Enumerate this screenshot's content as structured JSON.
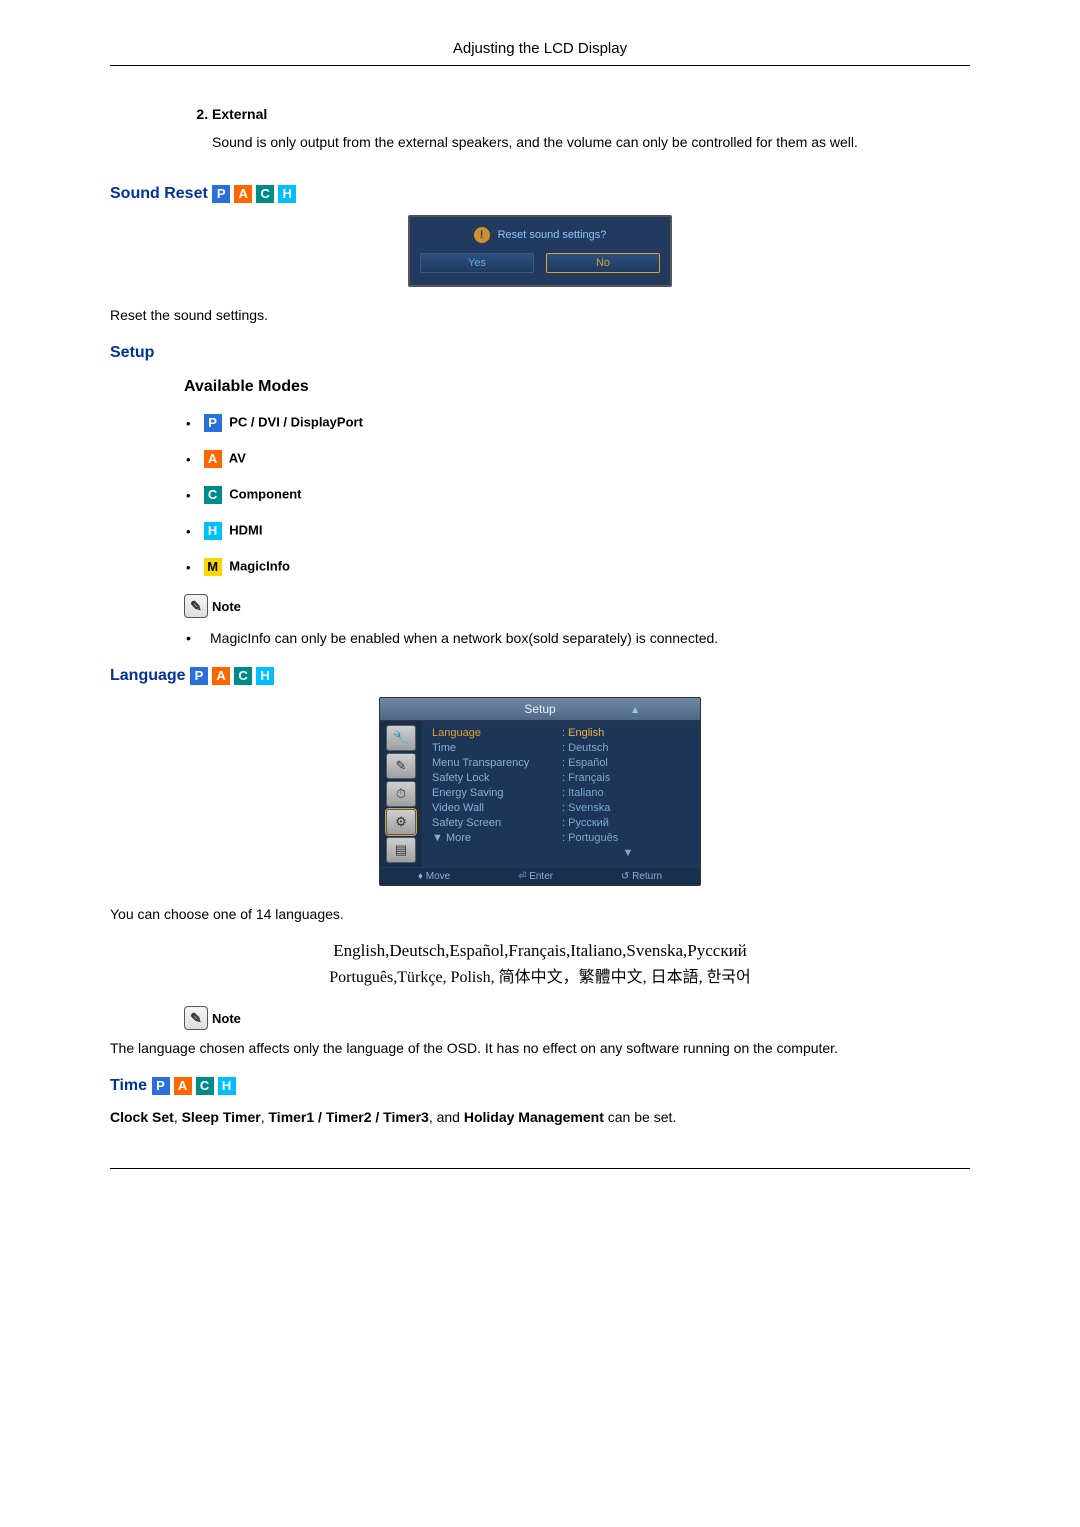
{
  "header": {
    "title": "Adjusting the LCD Display"
  },
  "ext": {
    "num": "2.",
    "label": "External",
    "desc": "Sound is only output from the external speakers, and the volume can only be controlled for them as well."
  },
  "soundReset": {
    "title": "Sound Reset",
    "dialog": {
      "prompt": "Reset sound settings?",
      "yes": "Yes",
      "no": "No"
    },
    "desc": "Reset the sound settings."
  },
  "setup": {
    "title": "Setup",
    "availableModes": "Available Modes",
    "modes": {
      "p": "PC / DVI / DisplayPort",
      "a": "AV",
      "c": "Component",
      "h": "HDMI",
      "m": "MagicInfo"
    },
    "badges": {
      "p": "P",
      "a": "A",
      "c": "C",
      "h": "H",
      "m": "M"
    },
    "note_label": "Note",
    "note_text": "MagicInfo can only be enabled when a network box(sold separately) is connected."
  },
  "language": {
    "title": "Language",
    "osd": {
      "title": "Setup",
      "labels": [
        "Language",
        "Time",
        "Menu Transparency",
        "Safety Lock",
        "Energy Saving",
        "Video Wall",
        "Safety Screen",
        "▼ More"
      ],
      "values": [
        "English",
        "Deutsch",
        "Español",
        "Français",
        "Italiano",
        "Svenska",
        "Русский",
        "Português",
        "▼"
      ],
      "foot": {
        "move": "Move",
        "enter": "Enter",
        "return": "Return"
      }
    },
    "intro": "You can choose one of 14 languages.",
    "list_line1": "English,Deutsch,Español,Français,Italiano,Svenska,Русский",
    "list_line2": "Português,Türkçe, Polish, 简体中文，繁體中文, 日本語, 한국어",
    "note_label": "Note",
    "note_text": "The language chosen affects only the language of the OSD. It has no effect on any software running on the computer."
  },
  "time": {
    "title": "Time",
    "desc_pre": "",
    "items": {
      "clock": "Clock Set",
      "sleep": "Sleep Timer",
      "timers": "Timer1 / Timer2 / Timer3",
      "holiday": "Holiday Management"
    },
    "desc_mid_and": ", and ",
    "desc_suffix": " can be set."
  }
}
